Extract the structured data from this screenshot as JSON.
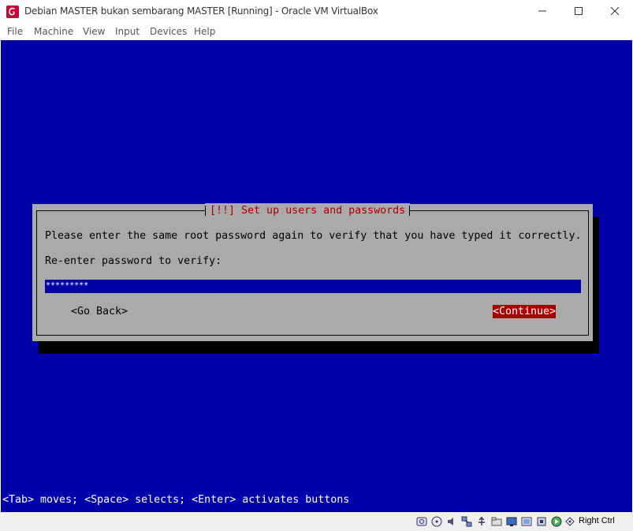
{
  "window": {
    "title": "Debian MASTER bukan sembarang MASTER [Running] - Oracle VM VirtualBox"
  },
  "menu": [
    "File",
    "Machine",
    "View",
    "Input",
    "Devices",
    "Help"
  ],
  "installer": {
    "dialog_title": "[!!] Set up users and passwords",
    "message": "Please enter the same root password again to verify that you have typed it correctly.",
    "prompt": "Re-enter password to verify:",
    "password_mask": "*********",
    "back_button": "<Go Back>",
    "continue_button": "<Continue>",
    "help_text": "<Tab> moves; <Space> selects; <Enter> activates buttons"
  },
  "statusbar": {
    "icons": [
      "hard-disk-icon",
      "optical-drive-icon",
      "audio-icon",
      "network-icon",
      "usb-icon",
      "shared-folders-icon",
      "display-icon",
      "video-capture-icon",
      "cpu-icon",
      "mouse-integration-icon",
      "keyboard-icon"
    ],
    "host_key": "Right Ctrl"
  }
}
